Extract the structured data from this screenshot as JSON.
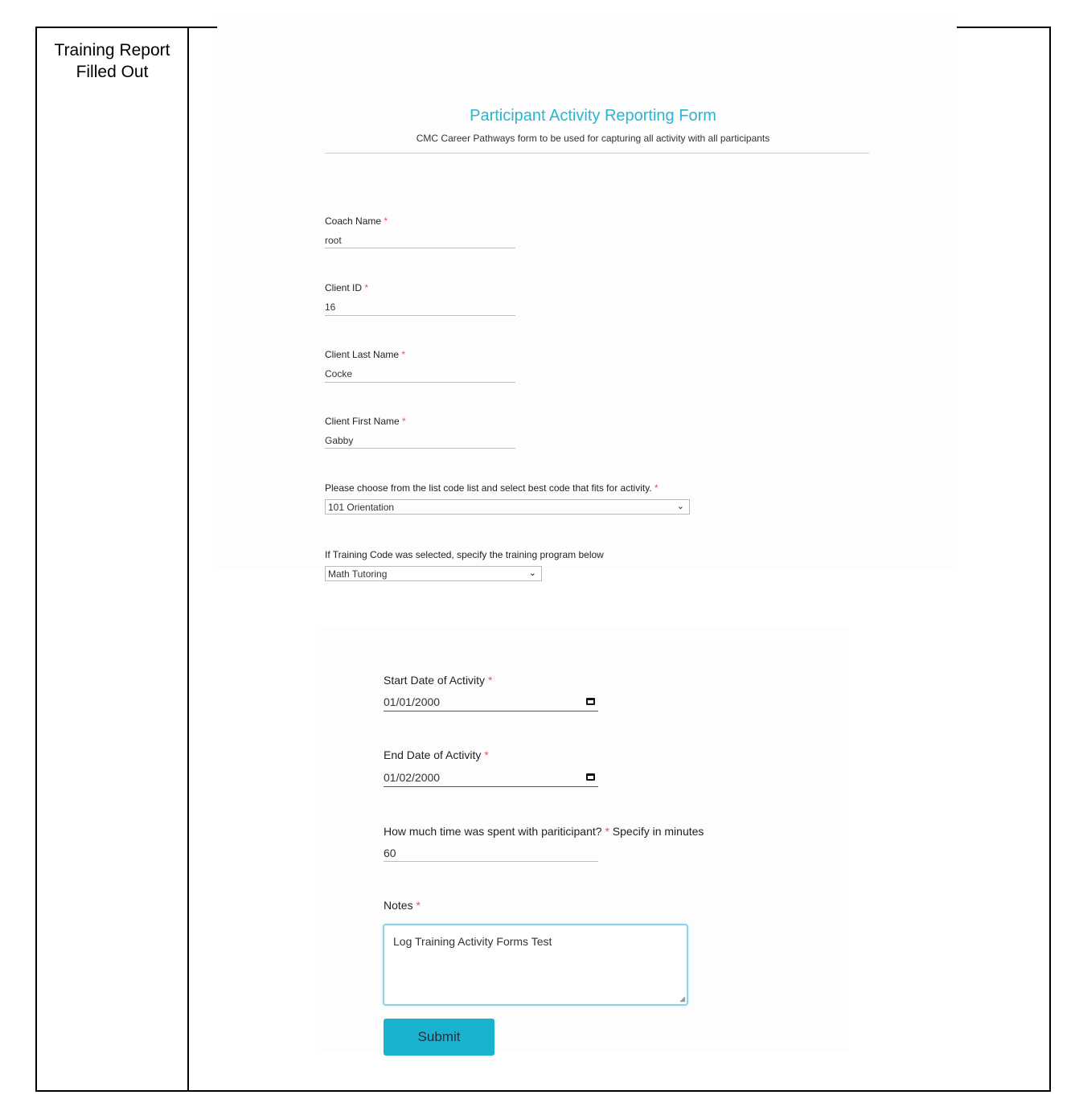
{
  "row_label": "Training Report Filled Out",
  "form": {
    "title": "Participant Activity Reporting Form",
    "subtitle": "CMC Career Pathways form to be used for capturing all activity with all participants",
    "required_mark": "*",
    "coach_name": {
      "label": "Coach Name",
      "value": "root"
    },
    "client_id": {
      "label": "Client ID",
      "value": "16"
    },
    "client_last_name": {
      "label": "Client Last Name",
      "value": "Cocke"
    },
    "client_first_name": {
      "label": "Client First Name",
      "value": "Gabby"
    },
    "activity_code": {
      "label": "Please choose from the list code list and select best code that fits for activity.",
      "value": "101 Orientation"
    },
    "training_program": {
      "label": "If Training Code was selected, specify the training program below",
      "value": "Math Tutoring"
    },
    "start_date": {
      "label": "Start Date of Activity",
      "value": "01/01/2000"
    },
    "end_date": {
      "label": "End Date of Activity",
      "value": "01/02/2000"
    },
    "time_spent": {
      "label": "How much time was spent with pariticipant?",
      "hint": "Specify in minutes",
      "value": "60"
    },
    "notes": {
      "label": "Notes",
      "value": "Log Training Activity Forms Test"
    },
    "submit_label": "Submit"
  },
  "icons": {
    "dropdown": "chevron-down-icon",
    "calendar": "calendar-icon",
    "resize": "resize-handle-icon"
  },
  "colors": {
    "title": "#2bb5d0",
    "required": "#e0565b",
    "submit": "#1ab3cf",
    "focus": "#8fd3e8"
  }
}
